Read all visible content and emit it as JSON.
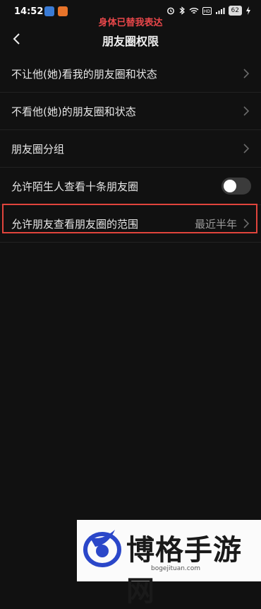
{
  "status_bar": {
    "time": "14:52",
    "battery": "62",
    "overlay_text": "身体已替我表达"
  },
  "nav": {
    "title": "朋友圈权限"
  },
  "rows": [
    {
      "label": "不让他(她)看我的朋友圈和状态"
    },
    {
      "label": "不看他(她)的朋友圈和状态"
    },
    {
      "label": "朋友圈分组"
    },
    {
      "label": "允许陌生人查看十条朋友圈",
      "toggle": false
    },
    {
      "label": "允许朋友查看朋友圈的范围",
      "value": "最近半年"
    }
  ],
  "watermark": {
    "title": "博格手游网",
    "url": "bogejituan.com"
  },
  "colors": {
    "background": "#111111",
    "highlight": "#e0443c",
    "overlay_text": "#e8474a"
  }
}
